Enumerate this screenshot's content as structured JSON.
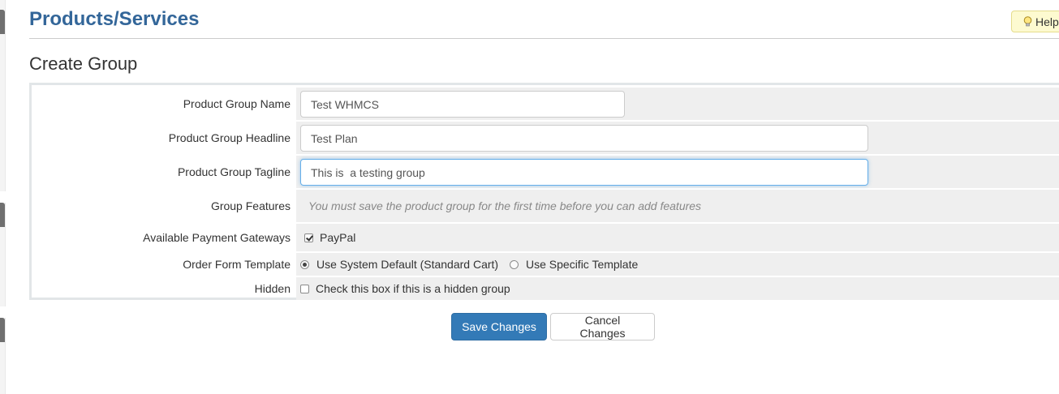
{
  "header": {
    "title": "Products/Services",
    "help_label": "Help"
  },
  "section": {
    "title": "Create Group"
  },
  "form": {
    "group_name": {
      "label": "Product Group Name",
      "value": "Test WHMCS"
    },
    "headline": {
      "label": "Product Group Headline",
      "value": "Test Plan"
    },
    "tagline": {
      "label": "Product Group Tagline",
      "value": "This is  a testing group"
    },
    "features": {
      "label": "Group Features",
      "note": "You must save the product group for the first time before you can add features"
    },
    "payment_gateways": {
      "label": "Available Payment Gateways",
      "options": [
        {
          "label": "PayPal",
          "checked": true
        }
      ]
    },
    "order_form_template": {
      "label": "Order Form Template",
      "options": [
        {
          "label": "Use System Default (Standard Cart)",
          "selected": true
        },
        {
          "label": "Use Specific Template",
          "selected": false
        }
      ]
    },
    "hidden": {
      "label": "Hidden",
      "checkbox_label": "Check this box if this is a hidden group",
      "checked": false
    }
  },
  "actions": {
    "save_label": "Save Changes",
    "cancel_label": "Cancel Changes"
  },
  "icons": {
    "help": "lightbulb-icon"
  },
  "colors": {
    "title": "#336699",
    "primary_button": "#337ab7",
    "field_background": "#efefef",
    "help_background": "#fdfad0"
  }
}
